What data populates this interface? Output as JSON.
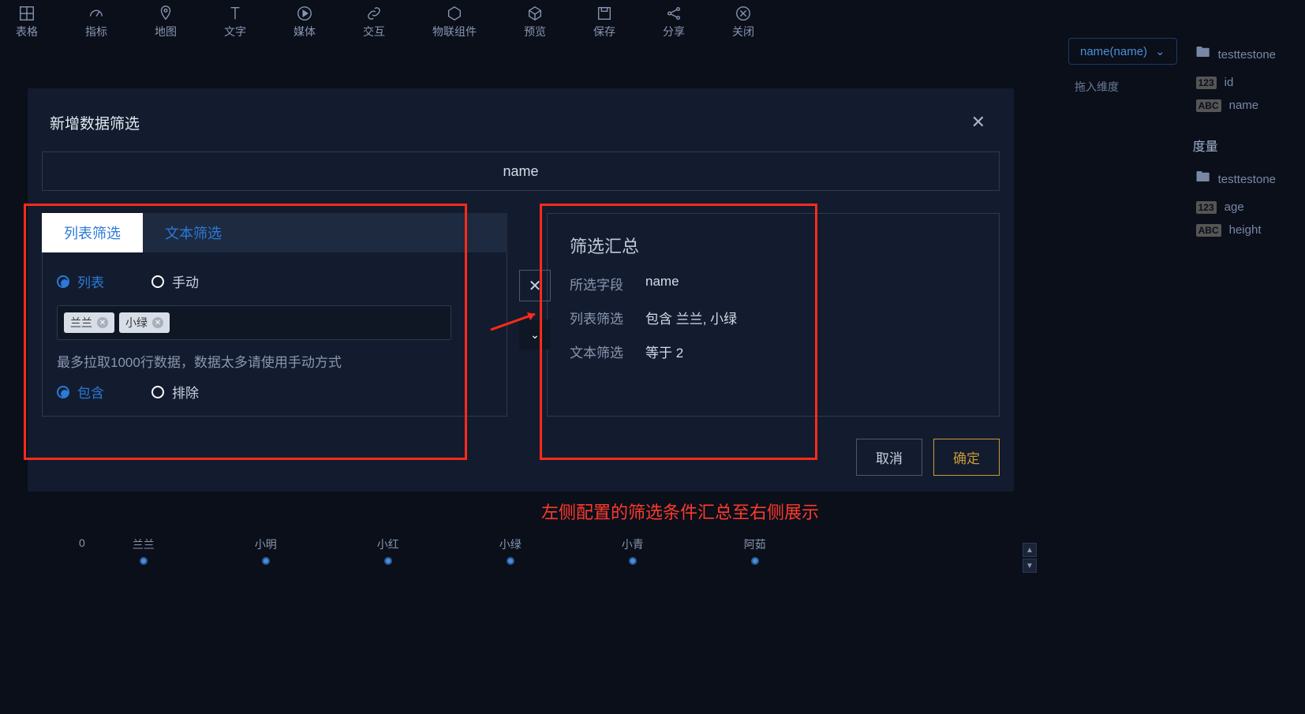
{
  "toolbar": [
    {
      "label": "表格"
    },
    {
      "label": "指标"
    },
    {
      "label": "地图"
    },
    {
      "label": "文字"
    },
    {
      "label": "媒体"
    },
    {
      "label": "交互"
    },
    {
      "label": "物联组件"
    },
    {
      "label": "预览"
    },
    {
      "label": "保存"
    },
    {
      "label": "分享"
    },
    {
      "label": "关闭"
    }
  ],
  "right_panel": {
    "pill": "name(name)",
    "dim_hint": "拖入维度",
    "group1": "testtestone",
    "g1_items": [
      {
        "type": "123",
        "name": "id"
      },
      {
        "type": "ABC",
        "name": "name"
      }
    ],
    "measure_label": "度量",
    "group2": "testtestone",
    "g2_items": [
      {
        "type": "123",
        "name": "age"
      },
      {
        "type": "ABC",
        "name": "height"
      }
    ]
  },
  "chart": {
    "zero": "0",
    "ticks": [
      "兰兰",
      "小明",
      "小红",
      "小绿",
      "小青",
      "阿茹"
    ]
  },
  "modal": {
    "title": "新增数据筛选",
    "field_name": "name",
    "tabs": [
      {
        "label": "列表筛选",
        "active": true
      },
      {
        "label": "文本筛选",
        "active": false
      }
    ],
    "radios_mode": {
      "list": "列表",
      "manual": "手动"
    },
    "tags": [
      "兰兰",
      "小绿"
    ],
    "hint": "最多拉取1000行数据，数据太多请使用手动方式",
    "radios_inc": {
      "include": "包含",
      "exclude": "排除"
    },
    "summary": {
      "title": "筛选汇总",
      "rows": [
        {
          "label": "所选字段",
          "value": "name"
        },
        {
          "label": "列表筛选",
          "value": "包含 兰兰, 小绿"
        },
        {
          "label": "文本筛选",
          "value": "等于 2"
        }
      ]
    },
    "cancel": "取消",
    "confirm": "确定"
  },
  "annotation": "左侧配置的筛选条件汇总至右侧展示"
}
